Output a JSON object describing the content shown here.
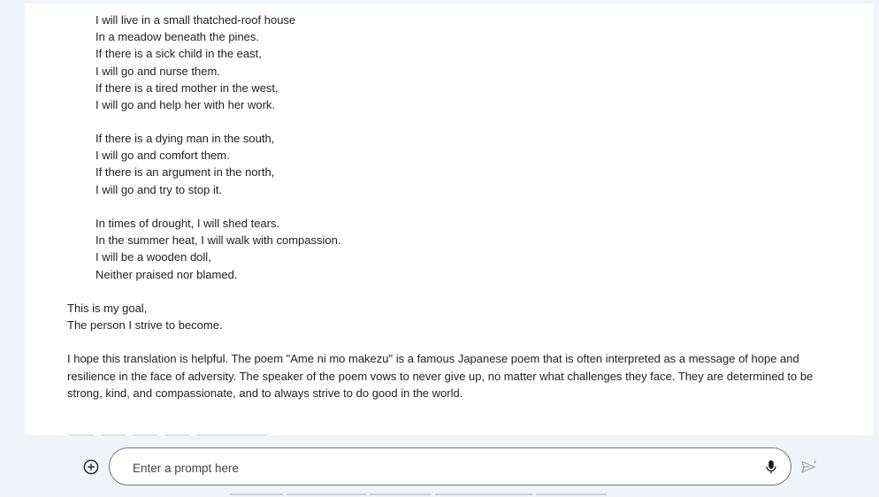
{
  "response": {
    "poem_stanzas": [
      [
        "I will live in a small thatched-roof house",
        "In a meadow beneath the pines.",
        "If there is a sick child in the east,",
        "I will go and nurse them.",
        "If there is a tired mother in the west,",
        "I will go and help her with her work."
      ],
      [
        "If there is a dying man in the south,",
        "I will go and comfort them.",
        "If there is an argument in the north,",
        "I will go and try to stop it."
      ],
      [
        "In times of drought, I will shed tears.",
        "In the summer heat, I will walk with compassion.",
        "I will be a wooden doll,",
        "Neither praised nor blamed."
      ]
    ],
    "closing_lines": [
      "This is my goal,",
      "The person I strive to become."
    ],
    "summary": "I hope this translation is helpful. The poem \"Ame ni mo makezu\" is a famous Japanese poem that is often interpreted as a message of hope and resilience in the face of adversity. The speaker of the poem vows to never give up, no matter what challenges they face. They are determined to be strong, kind, and compassionate, and to always strive to do good in the world."
  },
  "input": {
    "placeholder": "Enter a prompt here",
    "add_icon": "plus-circle-icon",
    "mic_icon": "microphone-icon",
    "send_icon": "send-icon"
  },
  "colors": {
    "page_background": "#f0f4f9",
    "card_background": "#ffffff",
    "text": "#1f1f1f",
    "input_border": "#747775"
  }
}
